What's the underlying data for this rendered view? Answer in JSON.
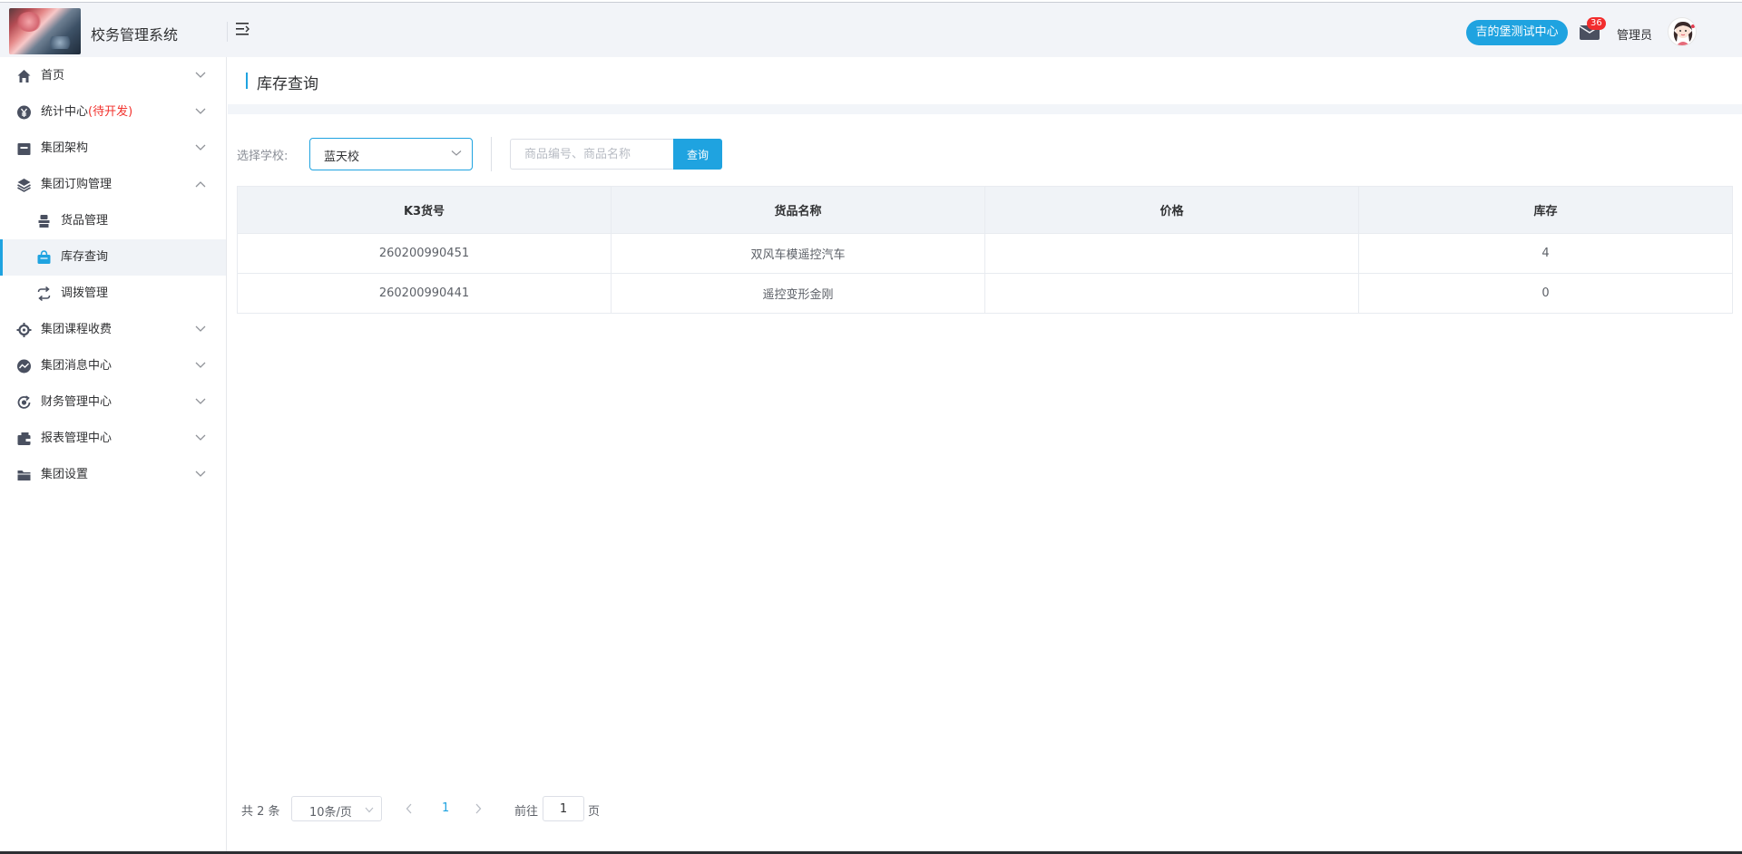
{
  "header": {
    "app_title": "校务管理系统",
    "center_button": "吉的堡测试中心",
    "mail_badge": "36",
    "user_name": "管理员",
    "accent": "#1fa3e0"
  },
  "sidebar": {
    "items": [
      {
        "label": "首页",
        "icon": "home-icon"
      },
      {
        "label": "统计中心",
        "suffix": "(待开发)",
        "icon": "yen-icon"
      },
      {
        "label": "集团架构",
        "icon": "building-icon"
      },
      {
        "label": "集团订购管理",
        "icon": "layers-icon",
        "expanded": true
      },
      {
        "label": "货品管理",
        "icon": "goods-icon"
      },
      {
        "label": "库存查询",
        "icon": "bag-icon",
        "active": true
      },
      {
        "label": "调拨管理",
        "icon": "transfer-icon"
      },
      {
        "label": "集团课程收费",
        "icon": "crosshair-icon"
      },
      {
        "label": "集团消息中心",
        "icon": "chart-circle-icon"
      },
      {
        "label": "财务管理中心",
        "icon": "refresh-money-icon"
      },
      {
        "label": "报表管理中心",
        "icon": "wallet-icon"
      },
      {
        "label": "集团设置",
        "icon": "folder-icon"
      }
    ]
  },
  "page": {
    "title": "库存查询",
    "filter_label": "选择学校:",
    "school_selected": "蓝天校",
    "search_placeholder": "商品编号、商品名称",
    "search_button": "查询"
  },
  "table": {
    "headers": [
      "K3货号",
      "货品名称",
      "价格",
      "库存"
    ],
    "rows": [
      [
        "260200990451",
        "双风车模遥控汽车",
        "",
        "4"
      ],
      [
        "260200990441",
        "遥控变形金刚",
        "",
        "0"
      ]
    ]
  },
  "pagination": {
    "total": "共 2 条",
    "page_size": "10条/页",
    "current_page": "1",
    "goto_label": "前往",
    "goto_value": "1",
    "page_unit": "页"
  }
}
